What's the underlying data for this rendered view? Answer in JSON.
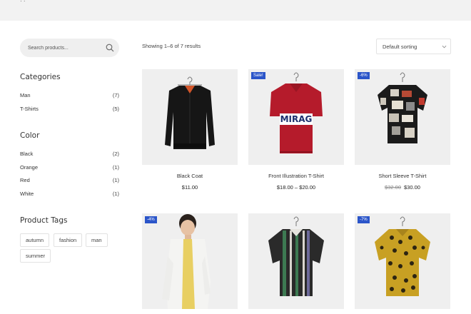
{
  "header": {
    "stub_text": "· ·"
  },
  "search": {
    "placeholder": "Search products..."
  },
  "categories": {
    "title": "Categories",
    "items": [
      {
        "label": "Man",
        "count": "(7)"
      },
      {
        "label": "T-Shirts",
        "count": "(5)"
      }
    ]
  },
  "color": {
    "title": "Color",
    "items": [
      {
        "label": "Black",
        "count": "(2)"
      },
      {
        "label": "Orange",
        "count": "(1)"
      },
      {
        "label": "Red",
        "count": "(1)"
      },
      {
        "label": "White",
        "count": "(1)"
      }
    ]
  },
  "tags": {
    "title": "Product Tags",
    "items": [
      "autumn",
      "fashion",
      "man",
      "summer"
    ]
  },
  "toolbar": {
    "result_count": "Showing 1–6 of 7 results",
    "sorting": "Default sorting"
  },
  "products": [
    {
      "title": "Black Coat",
      "badge": "",
      "price_old": "",
      "price": "$11.00"
    },
    {
      "title": "Front Illustration T-Shirt",
      "badge": "Sale!",
      "price_old": "",
      "price": "$18.00 – $20.00",
      "print_text": "MIRAG"
    },
    {
      "title": "Short Sleeve T-Shirt",
      "badge": "-6%",
      "price_old": "$32.00",
      "price": "$30.00"
    },
    {
      "title": "",
      "badge": "-4%",
      "price_old": "",
      "price": ""
    },
    {
      "title": "",
      "badge": "",
      "price_old": "",
      "price": ""
    },
    {
      "title": "",
      "badge": "-7%",
      "price_old": "",
      "price": ""
    }
  ],
  "colors": {
    "badge": "#2b55c9",
    "card_bg": "#efefef",
    "topbar": "#f2f2f2"
  }
}
